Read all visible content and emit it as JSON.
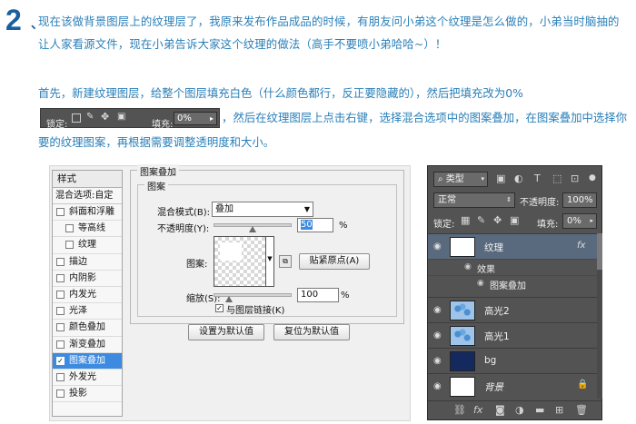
{
  "step": {
    "number": "2",
    "comma": "、"
  },
  "para1": "现在该做背景图层上的纹理层了，我原来发布作品成品的时候，有朋友问小弟这个纹理是怎么做的，小弟当时脑抽的让人家看源文件，现在小弟告诉大家这个纹理的做法（高手不要喷小弟哈哈~）！",
  "para2": {
    "before": "首先，新建纹理图层，给整个图层填充白色（什么颜色都行，反正要隐藏的），然后把填充改为0%",
    "after": "，然后在纹理图层上点击右键，选择混合选项中的图案叠加，在图案叠加中选择你要的纹理图案，再根据需要调整透明度和大小。"
  },
  "inline_toolbar": {
    "lock_label": "锁定:",
    "fill_label": "填充:",
    "fill_value": "0%"
  },
  "dialog": {
    "styles_header": "样式",
    "blend_options": "混合选项:自定",
    "effects": [
      {
        "label": "斜面和浮雕",
        "checked": false,
        "indent": false,
        "selected": false
      },
      {
        "label": "等高线",
        "checked": false,
        "indent": true,
        "selected": false
      },
      {
        "label": "纹理",
        "checked": false,
        "indent": true,
        "selected": false
      },
      {
        "label": "描边",
        "checked": false,
        "indent": false,
        "selected": false
      },
      {
        "label": "内阴影",
        "checked": false,
        "indent": false,
        "selected": false
      },
      {
        "label": "内发光",
        "checked": false,
        "indent": false,
        "selected": false
      },
      {
        "label": "光泽",
        "checked": false,
        "indent": false,
        "selected": false
      },
      {
        "label": "颜色叠加",
        "checked": false,
        "indent": false,
        "selected": false
      },
      {
        "label": "渐变叠加",
        "checked": false,
        "indent": false,
        "selected": false
      },
      {
        "label": "图案叠加",
        "checked": true,
        "indent": false,
        "selected": true
      },
      {
        "label": "外发光",
        "checked": false,
        "indent": false,
        "selected": false
      },
      {
        "label": "投影",
        "checked": false,
        "indent": false,
        "selected": false
      }
    ],
    "group_title": "图案叠加",
    "subgroup_title": "图案",
    "blend_mode_label": "混合模式(B):",
    "blend_mode_value": "叠加",
    "opacity_label": "不透明度(Y):",
    "opacity_value": "50",
    "opacity_unit": "%",
    "opacity_fraction": 0.5,
    "pattern_label": "图案:",
    "snap_origin_label": "贴紧原点(A)",
    "scale_label": "缩放(S):",
    "scale_value": "100",
    "scale_unit": "%",
    "scale_fraction": 0.2,
    "link_label": "与图层链接(K)",
    "link_checked": true,
    "default_btn": "设置为默认值",
    "reset_btn": "复位为默认值"
  },
  "layers_panel": {
    "filter_label": "类型",
    "blend_mode": "正常",
    "opacity_label": "不透明度:",
    "opacity_value": "100%",
    "lock_label": "锁定:",
    "fill_label": "填充:",
    "fill_value": "0%",
    "layers": [
      {
        "name": "纹理",
        "thumb": "#ffffff",
        "fx": "fx",
        "italic": false,
        "locked": false
      },
      {
        "name": "高光2",
        "thumb": "pattern-blue",
        "fx": "",
        "italic": false,
        "locked": false
      },
      {
        "name": "高光1",
        "thumb": "pattern-blue",
        "fx": "",
        "italic": false,
        "locked": false
      },
      {
        "name": "bg",
        "thumb": "#142a5e",
        "fx": "",
        "italic": false,
        "locked": false
      },
      {
        "name": "背景",
        "thumb": "#ffffff",
        "fx": "",
        "italic": true,
        "locked": true
      }
    ],
    "effects_label": "效果",
    "effect_name": "图案叠加",
    "selected_color": "#5a6a7e"
  }
}
